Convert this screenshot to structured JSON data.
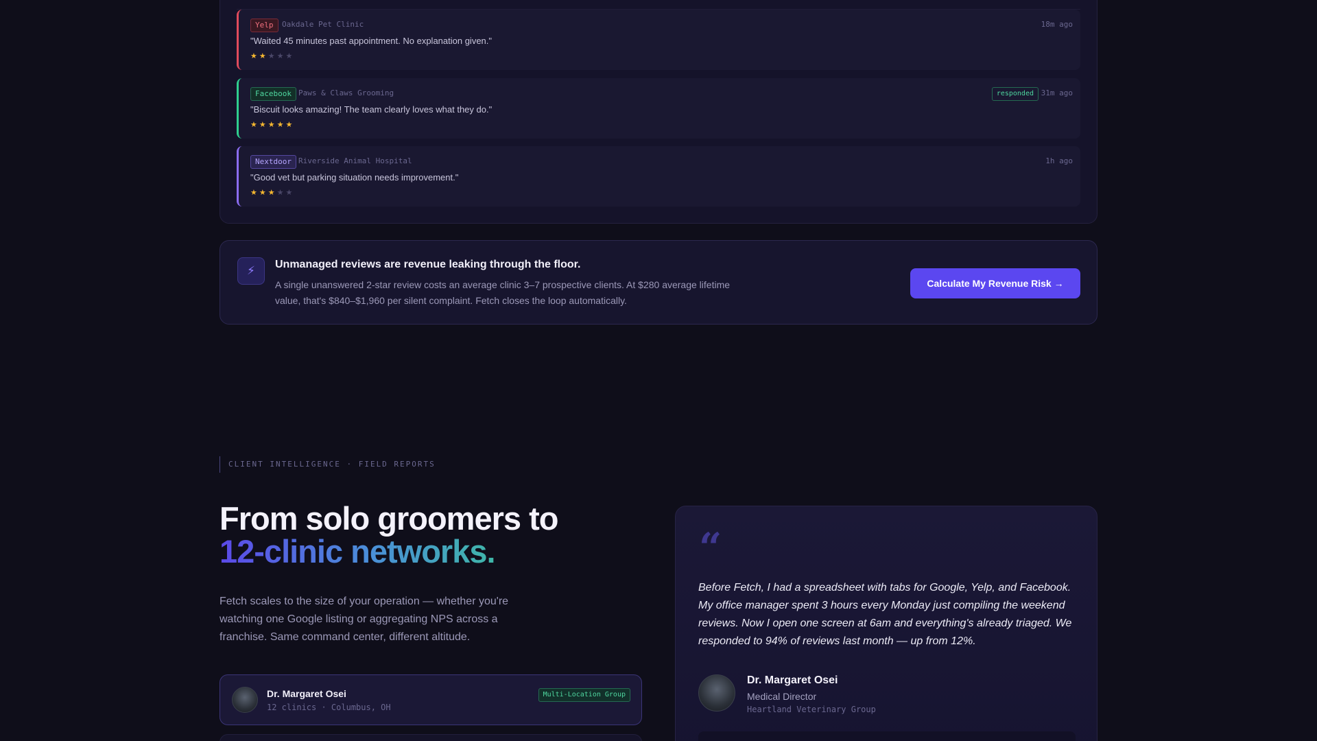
{
  "reviews": [
    {
      "platform": "Yelp",
      "clinic": "Oakdale Pet Clinic",
      "text": "\"Waited 45 minutes past appointment. No explanation given.\"",
      "time": "18m ago",
      "stars": "★★",
      "stars_off": "★★★",
      "rating": 2
    },
    {
      "platform": "Facebook",
      "clinic": "Paws & Claws Grooming",
      "text": "\"Biscuit looks amazing! The team clearly loves what they do.\"",
      "time": "31m ago",
      "status": "responded",
      "stars": "★★★★★",
      "stars_off": "",
      "rating": 5
    },
    {
      "platform": "Nextdoor",
      "clinic": "Riverside Animal Hospital",
      "text": "\"Good vet but parking situation needs improvement.\"",
      "time": "1h ago",
      "stars": "★★★",
      "stars_off": "★★",
      "rating": 3
    }
  ],
  "alert": {
    "icon": "⚡",
    "icon_name": "lightning-icon",
    "title": "Unmanaged reviews are revenue leaking through the floor.",
    "body": "A single unanswered 2-star review costs an average clinic 3–7 prospective clients. At $280 average lifetime value, that's $840–$1,960 per silent complaint. Fetch closes the loop automatically.",
    "button": "Calculate My Revenue Risk →"
  },
  "section": {
    "eyebrow": "CLIENT INTELLIGENCE · FIELD REPORTS",
    "headline_1": "From solo groomers to",
    "headline_2": "12-clinic networks.",
    "lede": "Fetch scales to the size of your operation — whether you're watching one Google listing or aggregating NPS across a franchise. Same command center, different altitude."
  },
  "client_card": {
    "name": "Dr. Margaret Osei",
    "meta": "12 clinics · Columbus, OH",
    "tag": "Multi-Location Group"
  },
  "testimonial": {
    "quote_mark": "“",
    "text": "Before Fetch, I had a spreadsheet with tabs for Google, Yelp, and Facebook. My office manager spent 3 hours every Monday just compiling the weekend reviews. Now I open one screen at 6am and everything's already triaged. We responded to 94% of reviews last month — up from 12%.",
    "name": "Dr. Margaret Osei",
    "role": "Medical Director",
    "org": "Heartland Veterinary Group"
  },
  "colors": {
    "background": "#0f0e1a",
    "accent": "#5b47f0",
    "yelp": "#e04a5c",
    "success": "#2fcf8f",
    "nextdoor": "#8b6cf0",
    "star": "#f5b730"
  }
}
